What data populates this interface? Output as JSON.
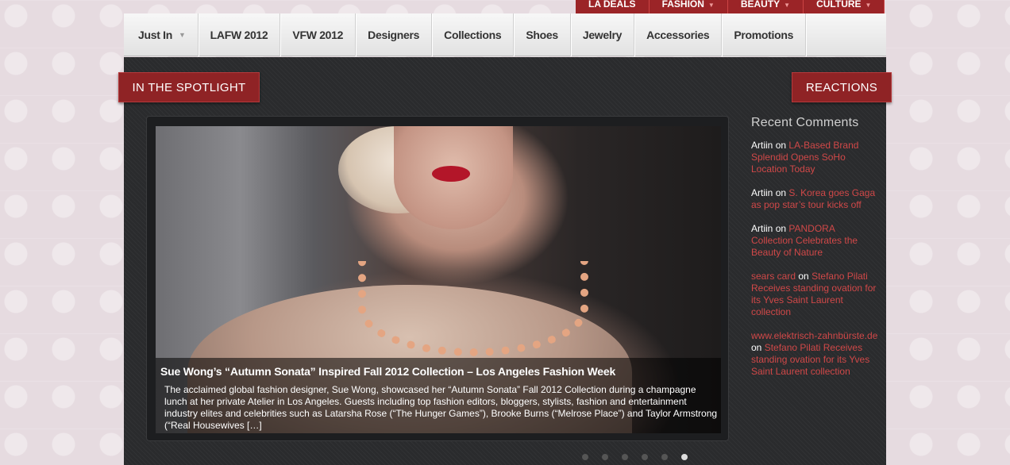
{
  "top_tabs": [
    {
      "label": "LA Deals",
      "has_dropdown": false
    },
    {
      "label": "Fashion",
      "has_dropdown": true
    },
    {
      "label": "Beauty",
      "has_dropdown": true
    },
    {
      "label": "Culture",
      "has_dropdown": true
    }
  ],
  "nav": {
    "items": [
      {
        "label": "Just In",
        "has_dropdown": true
      },
      {
        "label": "LAFW 2012"
      },
      {
        "label": "VFW 2012"
      },
      {
        "label": "Designers"
      },
      {
        "label": "Collections"
      },
      {
        "label": "Shoes"
      },
      {
        "label": "Jewelry"
      },
      {
        "label": "Accessories"
      },
      {
        "label": "Promotions"
      }
    ]
  },
  "spotlight": {
    "heading": "IN THE SPOTLIGHT",
    "slide": {
      "title": "Sue Wong’s “Autumn Sonata” Inspired Fall 2012 Collection – Los Angeles Fashion Week",
      "excerpt": "The acclaimed global fashion designer, Sue Wong, showcased her “Autumn Sonata” Fall 2012 Collection during a champagne lunch at her private Atelier in Los Angeles. Guests including top fashion editors, bloggers, stylists, fashion and entertainment industry elites and celebrities such as Latarsha Rose (“The Hunger Games”), Brooke Burns (“Melrose Place”) and Taylor Armstrong (“Real Housewives […]"
    },
    "dots_count": 6,
    "active_dot": 6
  },
  "reactions": {
    "heading": "REACTIONS",
    "recent_heading": "Recent Comments",
    "comments": [
      {
        "author": "Artiin",
        "author_is_link": false,
        "on": "on",
        "post": "LA-Based Brand Splendid Opens SoHo Location Today"
      },
      {
        "author": "Artiin",
        "author_is_link": false,
        "on": "on",
        "post": "S. Korea goes Gaga as pop star’s tour kicks off"
      },
      {
        "author": "Artiin",
        "author_is_link": false,
        "on": "on",
        "post": "PANDORA Collection Celebrates the Beauty of Nature"
      },
      {
        "author": "sears card",
        "author_is_link": true,
        "on": "on",
        "post": "Stefano Pilati Receives standing ovation for its Yves Saint Laurent collection"
      },
      {
        "author": "www.elektrisch-zahnbürste.de",
        "author_is_link": true,
        "on": "on",
        "post": "Stefano Pilati Receives standing ovation for its Yves Saint Laurent collection"
      }
    ]
  },
  "colors": {
    "accent_red": "#9b2427",
    "link_red": "#d04848",
    "dark_bg": "#2a2b2d"
  }
}
